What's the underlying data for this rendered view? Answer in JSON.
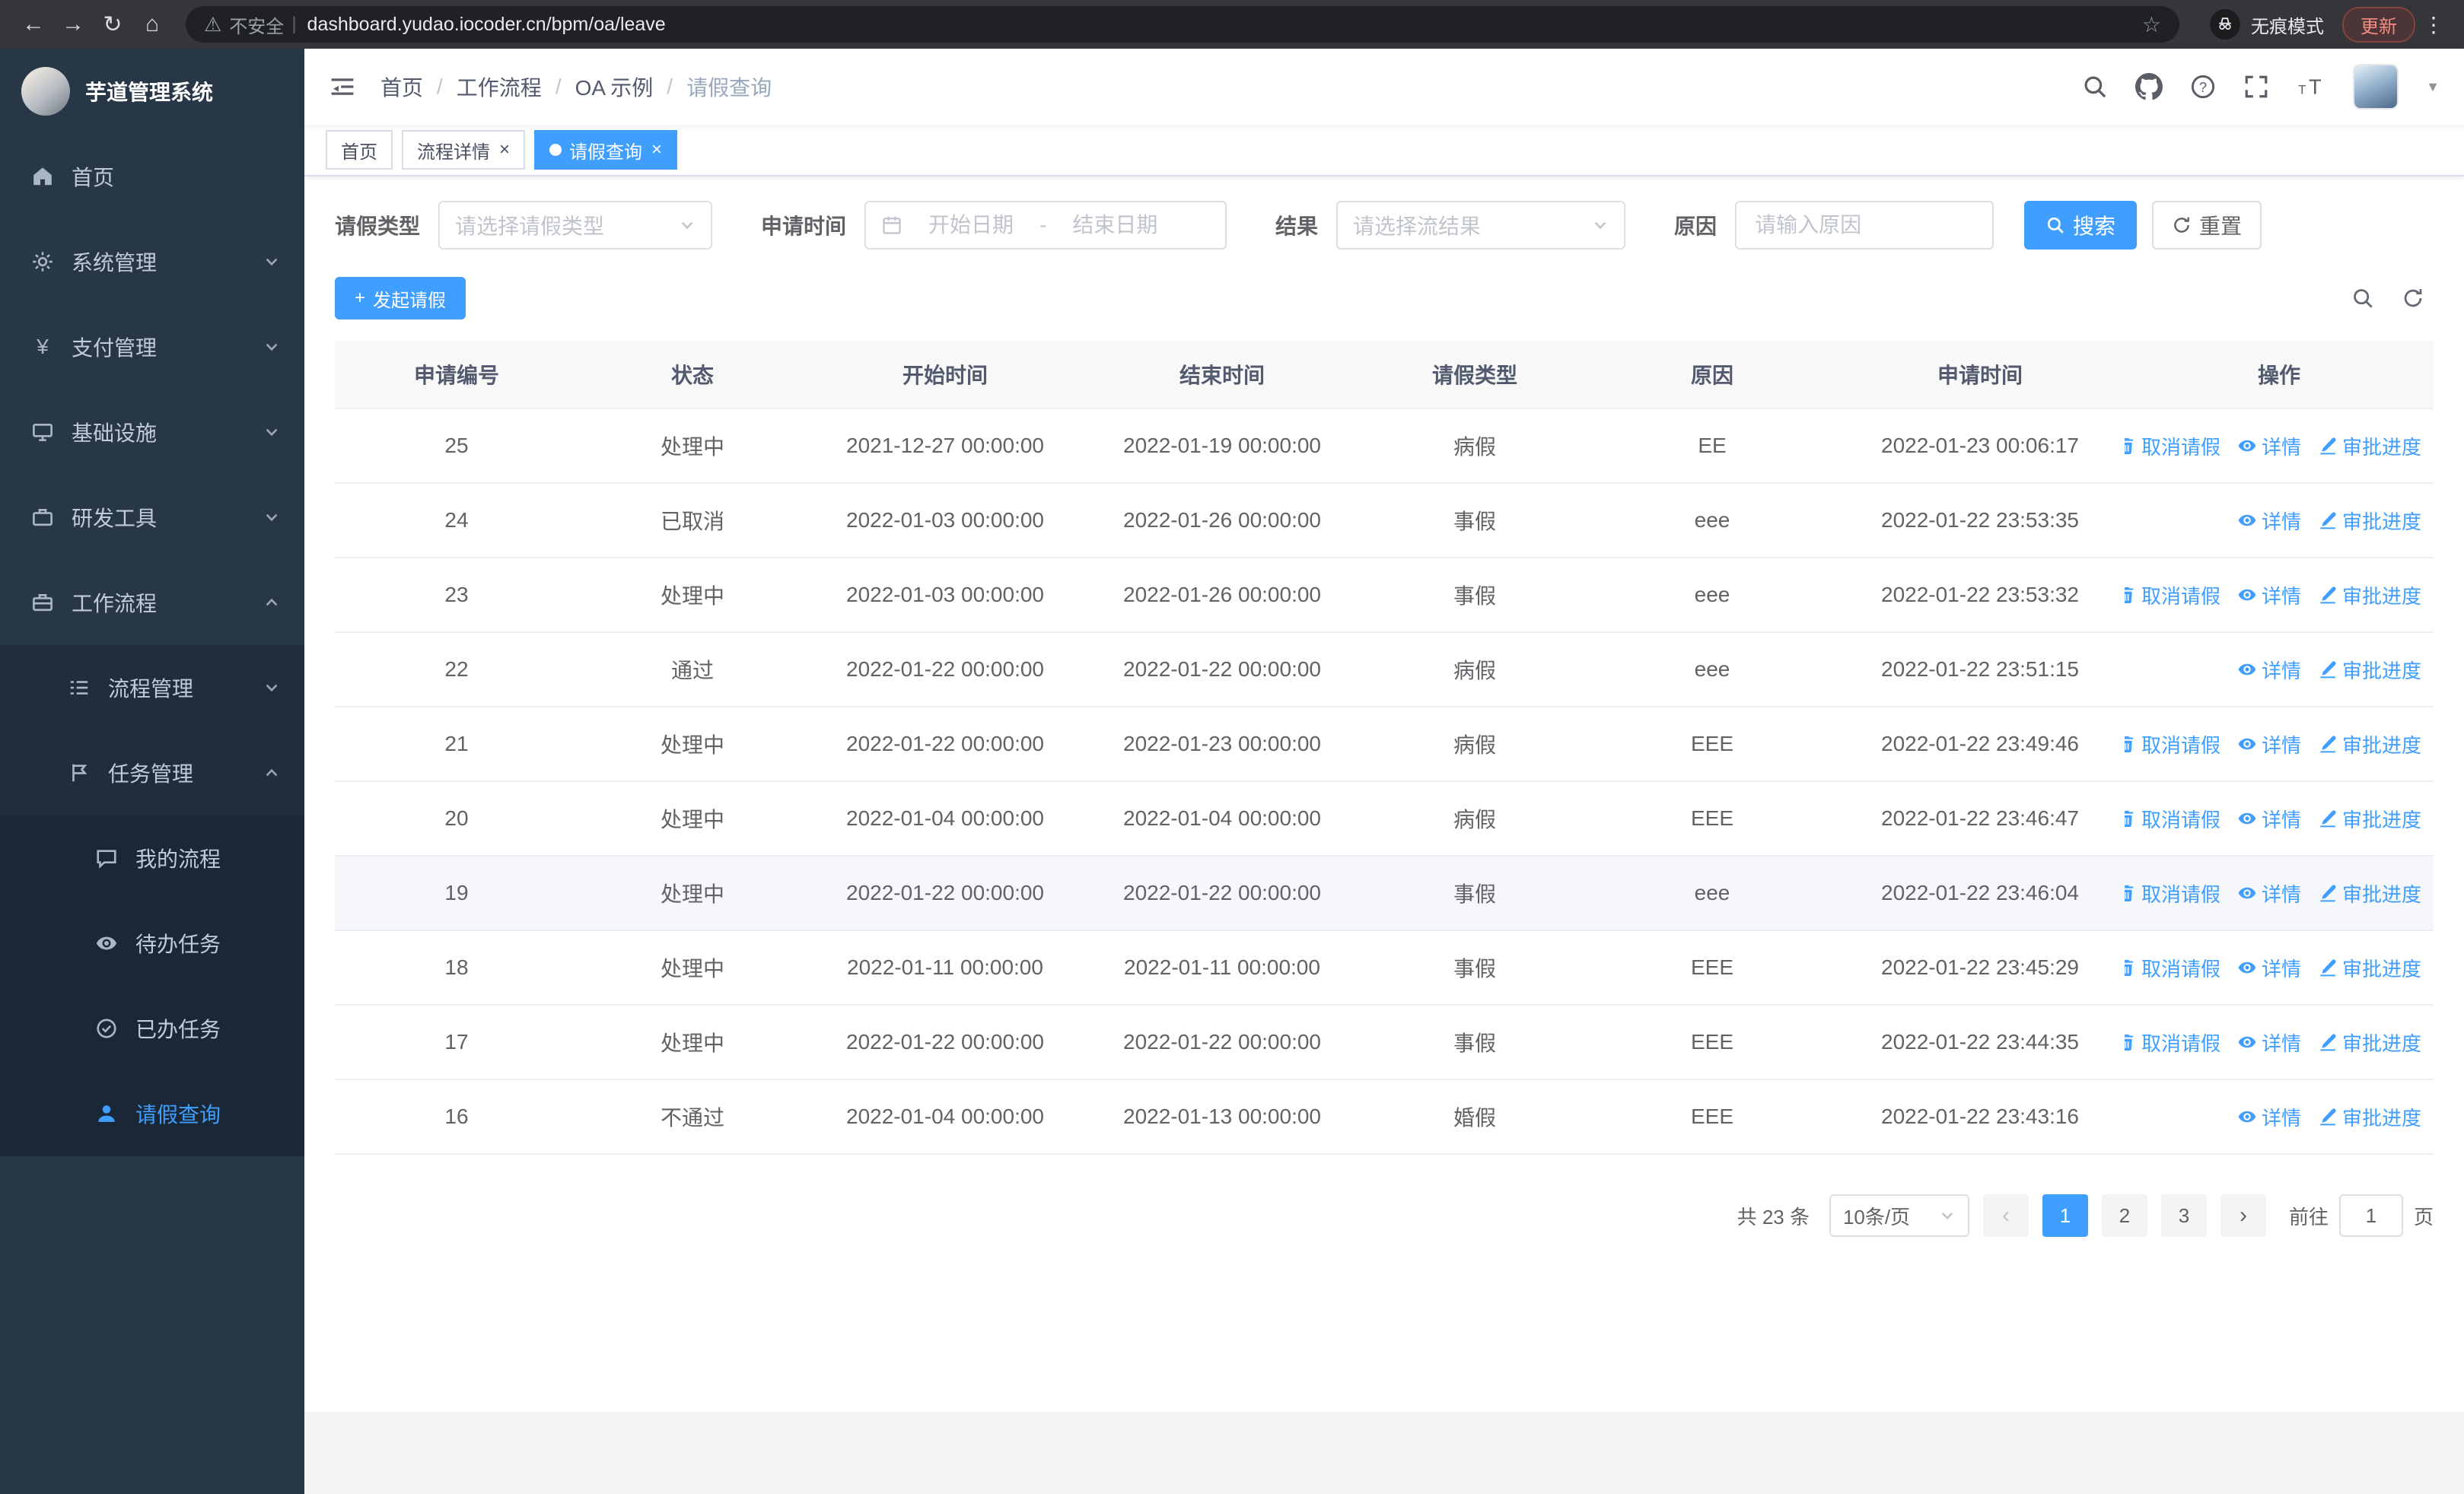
{
  "browser": {
    "security_label": "不安全",
    "url": "dashboard.yudao.iocoder.cn/bpm/oa/leave",
    "incognito_label": "无痕模式",
    "update_label": "更新"
  },
  "colors": {
    "accent": "#409eff",
    "sidebar_bg": "#283747",
    "sidebar_submenu_bg": "#1f2d3d",
    "active_page_bg": "#409eff"
  },
  "sidebar": {
    "logo_title": "芋道管理系统",
    "menu": {
      "home": "首页",
      "system": "系统管理",
      "pay": "支付管理",
      "infra": "基础设施",
      "dev_tools": "研发工具",
      "workflow": "工作流程",
      "process_mgmt": "流程管理",
      "task_mgmt": "任务管理",
      "my_process": "我的流程",
      "todo_tasks": "待办任务",
      "done_tasks": "已办任务",
      "leave_query": "请假查询"
    }
  },
  "header": {
    "breadcrumb": [
      "首页",
      "工作流程",
      "OA 示例",
      "请假查询"
    ]
  },
  "tabs": [
    {
      "label": "首页"
    },
    {
      "label": "流程详情"
    },
    {
      "label": "请假查询"
    }
  ],
  "filters": {
    "leave_type_label": "请假类型",
    "leave_type_placeholder": "请选择请假类型",
    "apply_time_label": "申请时间",
    "start_date_placeholder": "开始日期",
    "range_separator": "-",
    "end_date_placeholder": "结束日期",
    "result_label": "结果",
    "result_placeholder": "请选择流结果",
    "reason_label": "原因",
    "reason_placeholder": "请输入原因",
    "search_button": "搜索",
    "reset_button": "重置"
  },
  "toolbar": {
    "create_button": "发起请假"
  },
  "table": {
    "columns": [
      "申请编号",
      "状态",
      "开始时间",
      "结束时间",
      "请假类型",
      "原因",
      "申请时间",
      "操作"
    ],
    "actions": {
      "cancel": "取消请假",
      "detail": "详情",
      "progress": "审批进度"
    },
    "rows": [
      {
        "id": "25",
        "status": "处理中",
        "start": "2021-12-27 00:00:00",
        "end": "2022-01-19 00:00:00",
        "type": "病假",
        "reason": "EE",
        "applied": "2022-01-23 00:06:17",
        "actions": [
          "cancel",
          "detail",
          "progress"
        ],
        "highlighted": false
      },
      {
        "id": "24",
        "status": "已取消",
        "start": "2022-01-03 00:00:00",
        "end": "2022-01-26 00:00:00",
        "type": "事假",
        "reason": "eee",
        "applied": "2022-01-22 23:53:35",
        "actions": [
          "detail",
          "progress"
        ],
        "highlighted": false
      },
      {
        "id": "23",
        "status": "处理中",
        "start": "2022-01-03 00:00:00",
        "end": "2022-01-26 00:00:00",
        "type": "事假",
        "reason": "eee",
        "applied": "2022-01-22 23:53:32",
        "actions": [
          "cancel",
          "detail",
          "progress"
        ],
        "highlighted": false
      },
      {
        "id": "22",
        "status": "通过",
        "start": "2022-01-22 00:00:00",
        "end": "2022-01-22 00:00:00",
        "type": "病假",
        "reason": "eee",
        "applied": "2022-01-22 23:51:15",
        "actions": [
          "detail",
          "progress"
        ],
        "highlighted": false
      },
      {
        "id": "21",
        "status": "处理中",
        "start": "2022-01-22 00:00:00",
        "end": "2022-01-23 00:00:00",
        "type": "病假",
        "reason": "EEE",
        "applied": "2022-01-22 23:49:46",
        "actions": [
          "cancel",
          "detail",
          "progress"
        ],
        "highlighted": false
      },
      {
        "id": "20",
        "status": "处理中",
        "start": "2022-01-04 00:00:00",
        "end": "2022-01-04 00:00:00",
        "type": "病假",
        "reason": "EEE",
        "applied": "2022-01-22 23:46:47",
        "actions": [
          "cancel",
          "detail",
          "progress"
        ],
        "highlighted": false
      },
      {
        "id": "19",
        "status": "处理中",
        "start": "2022-01-22 00:00:00",
        "end": "2022-01-22 00:00:00",
        "type": "事假",
        "reason": "eee",
        "applied": "2022-01-22 23:46:04",
        "actions": [
          "cancel",
          "detail",
          "progress"
        ],
        "highlighted": true
      },
      {
        "id": "18",
        "status": "处理中",
        "start": "2022-01-11 00:00:00",
        "end": "2022-01-11 00:00:00",
        "type": "事假",
        "reason": "EEE",
        "applied": "2022-01-22 23:45:29",
        "actions": [
          "cancel",
          "detail",
          "progress"
        ],
        "highlighted": false
      },
      {
        "id": "17",
        "status": "处理中",
        "start": "2022-01-22 00:00:00",
        "end": "2022-01-22 00:00:00",
        "type": "事假",
        "reason": "EEE",
        "applied": "2022-01-22 23:44:35",
        "actions": [
          "cancel",
          "detail",
          "progress"
        ],
        "highlighted": false
      },
      {
        "id": "16",
        "status": "不通过",
        "start": "2022-01-04 00:00:00",
        "end": "2022-01-13 00:00:00",
        "type": "婚假",
        "reason": "EEE",
        "applied": "2022-01-22 23:43:16",
        "actions": [
          "detail",
          "progress"
        ],
        "highlighted": false
      }
    ]
  },
  "pagination": {
    "total_text": "共 23 条",
    "page_size_text": "10条/页",
    "pages": [
      "1",
      "2",
      "3"
    ],
    "active_page": "1",
    "goto_prefix": "前往",
    "goto_value": "1",
    "goto_suffix": "页"
  }
}
